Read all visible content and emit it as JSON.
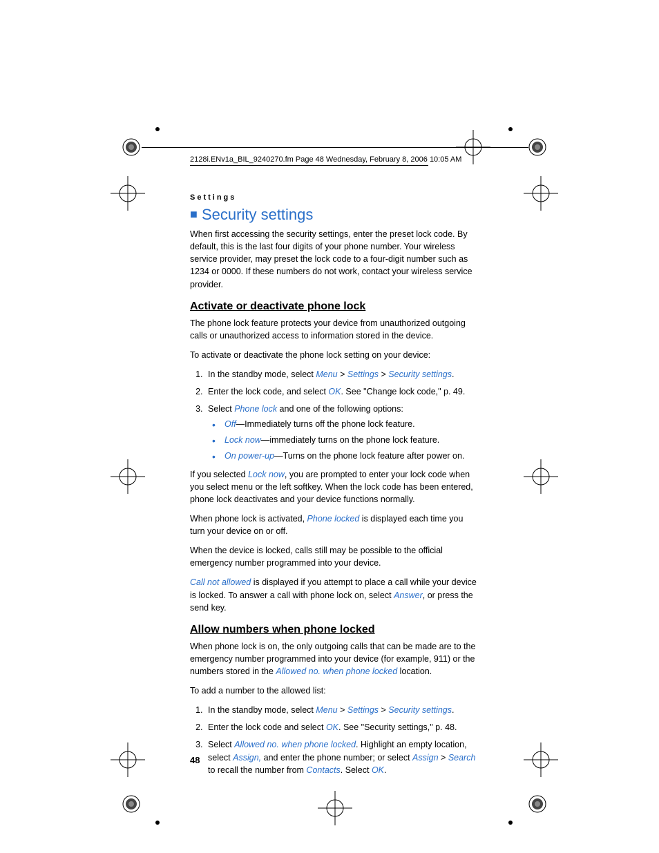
{
  "header_line": "2128i.ENv1a_BIL_9240270.fm  Page 48  Wednesday, February 8, 2006  10:05 AM",
  "section_label": "Settings",
  "main_heading": "Security settings",
  "intro": "When first accessing the security settings, enter the preset lock code. By default, this is the last four digits of your phone number. Your wireless service provider, may preset the lock code to a four-digit number such as 1234 or 0000. If these numbers do not work, contact your wireless service provider.",
  "sub1_heading": "Activate or deactivate phone lock",
  "sub1_p1": "The phone lock feature protects your device from unauthorized outgoing calls or unauthorized access to information stored in the device.",
  "sub1_p2": "To activate or deactivate the phone lock setting on your device:",
  "steps1": {
    "s1_a": "In the standby mode, select ",
    "s1_menu": "Menu",
    "s1_gt1": " > ",
    "s1_settings": "Settings",
    "s1_gt2": " > ",
    "s1_security": "Security settings",
    "s1_end": ".",
    "s2_a": "Enter the lock code, and select ",
    "s2_ok": "OK",
    "s2_b": ". See \"Change lock code,\" p. 49.",
    "s3_a": "Select ",
    "s3_phonelock": "Phone lock",
    "s3_b": " and one of the following options:"
  },
  "bullets1": {
    "b1_off": "Off",
    "b1_txt": "—Immediately turns off the phone lock feature.",
    "b2_locknow": "Lock now",
    "b2_txt": "—immediately turns on the phone lock feature.",
    "b3_onpower": "On power-up",
    "b3_txt": "—Turns on the phone lock feature after power on."
  },
  "p_after_bullets_a": "If you selected ",
  "p_after_bullets_locknow": "Lock now",
  "p_after_bullets_b": ", you are prompted to enter your lock code when you select menu or the left softkey. When the lock code has been entered, phone lock deactivates and your device functions normally.",
  "p_activated_a": "When phone lock is activated, ",
  "p_activated_em": "Phone locked",
  "p_activated_b": " is displayed each time you turn your device on or off.",
  "p_locked_calls": "When the device is locked, calls still may be possible to the official emergency number programmed into your device.",
  "p_cna_em": "Call not allowed",
  "p_cna_a": " is displayed if you attempt to place a call while your device is locked. To answer a call with phone lock on, select ",
  "p_cna_answer": "Answer",
  "p_cna_b": ", or press the send key.",
  "sub2_heading": "Allow numbers when phone locked",
  "sub2_p1_a": "When phone lock is on, the only outgoing calls that can be made are to the emergency number programmed into your device (for example, 911) or the numbers stored in the ",
  "sub2_p1_em": "Allowed no. when phone locked",
  "sub2_p1_b": " location.",
  "sub2_p2": "To add a number to the allowed list:",
  "steps2": {
    "s1_a": "In the standby mode, select ",
    "s1_menu": "Menu",
    "s1_gt1": " > ",
    "s1_settings": "Settings",
    "s1_gt2": " > ",
    "s1_security": "Security settings",
    "s1_end": ".",
    "s2_a": "Enter the lock code and select ",
    "s2_ok": "OK",
    "s2_b": ". See \"Security settings,\" p. 48.",
    "s3_a": "Select ",
    "s3_em1": "Allowed no. when phone locked",
    "s3_b": ". Highlight an empty location, select ",
    "s3_em2": "Assign,",
    "s3_c": " and enter the phone number; or select ",
    "s3_em3": "Assign",
    "s3_gt": " > ",
    "s3_em4": "Search",
    "s3_d": " to recall the number from ",
    "s3_em5": "Contacts",
    "s3_e": ". Select ",
    "s3_em6": "OK",
    "s3_f": "."
  },
  "page_number": "48"
}
